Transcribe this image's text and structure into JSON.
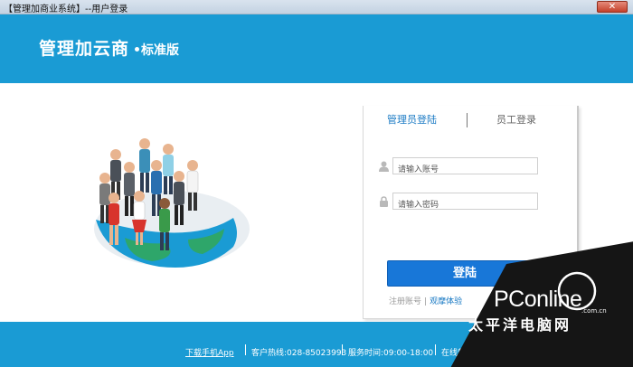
{
  "window": {
    "title": "【管理加商业系统】--用户登录",
    "close_label": "✕"
  },
  "header": {
    "brand": "管理加云商",
    "edition": "标准版"
  },
  "login": {
    "tabs": [
      {
        "label": "管理员登陆",
        "active": true
      },
      {
        "label": "员工登录",
        "active": false
      }
    ],
    "username_placeholder": "请输入账号",
    "password_placeholder": "请输入密码",
    "username_icon": "user-icon",
    "password_icon": "lock-icon",
    "submit_label": "登陆",
    "register_label": "注册账号",
    "demo_label": "观摩体验",
    "link_sep": "|"
  },
  "footer": {
    "app_link": "下载手机App",
    "hotline": "客户热线:028-85023993",
    "service_time": "服务时间:09:00-18:00",
    "help": "在线帮助"
  },
  "watermark": {
    "brand": "PConline",
    "domain": ".com.cn",
    "tagline": "太平洋电脑网"
  },
  "colors": {
    "brand_blue": "#1a9bd4",
    "button_blue": "#1877d8",
    "active_tab": "#1a7ac4"
  }
}
